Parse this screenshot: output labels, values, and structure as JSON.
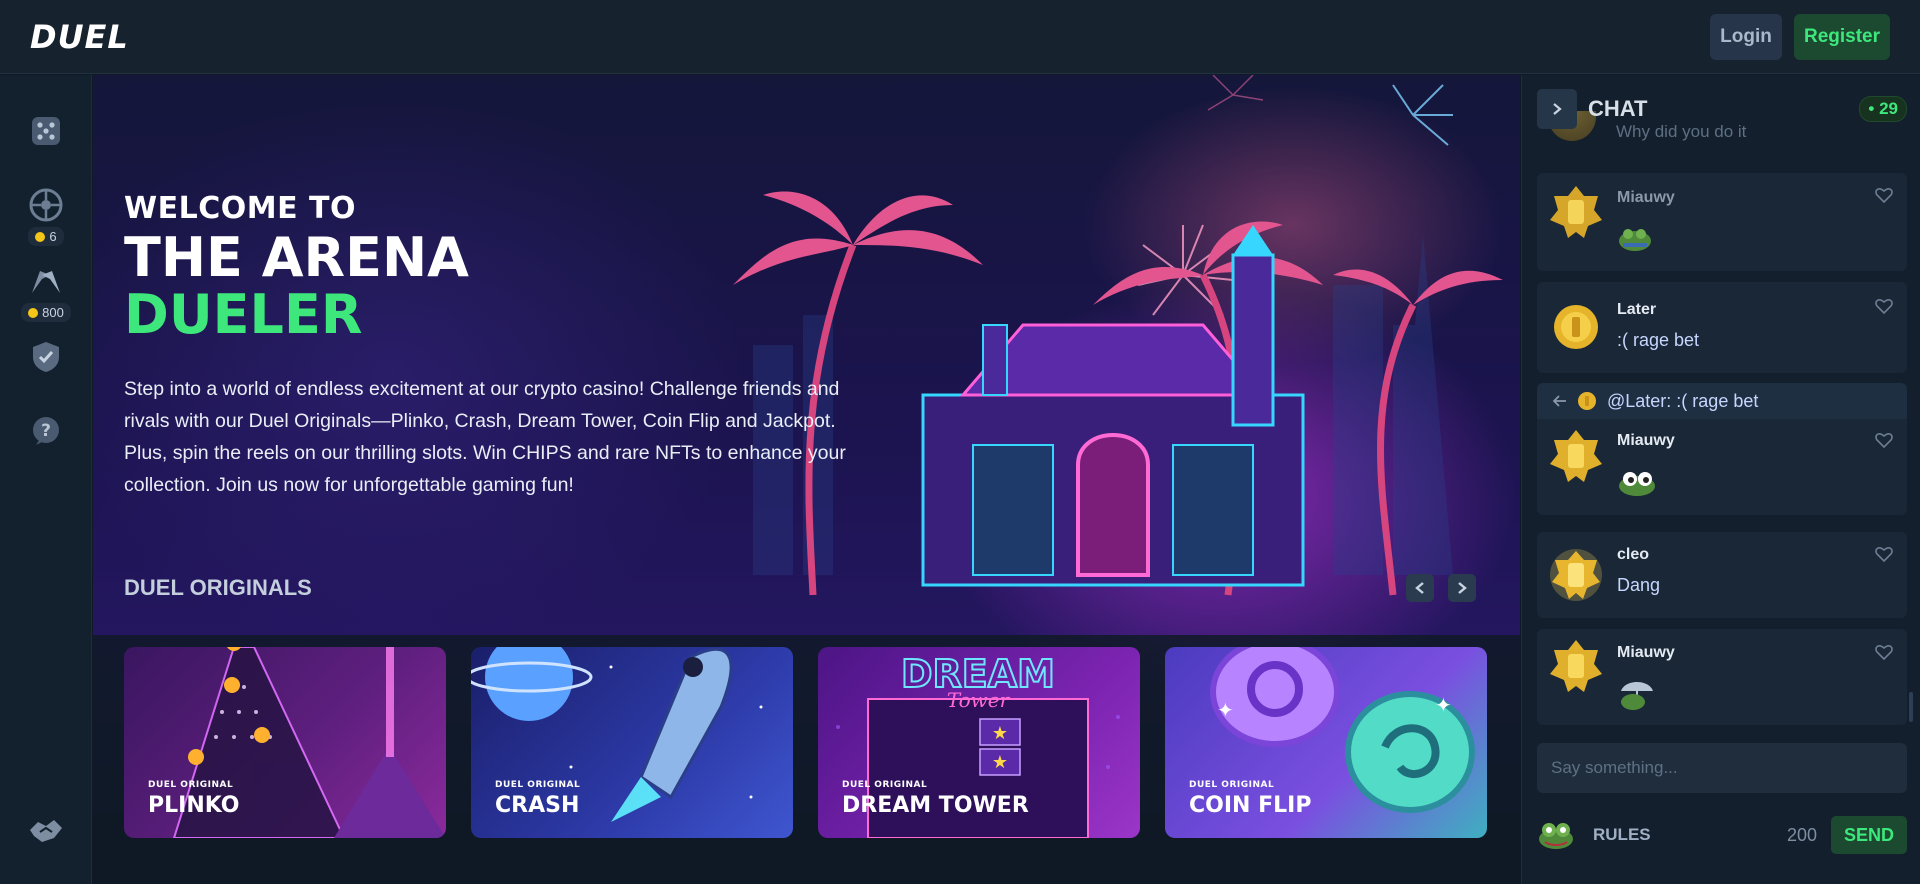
{
  "app": {
    "logo": "DUEL"
  },
  "header": {
    "login_label": "Login",
    "register_label": "Register"
  },
  "leftnav": {
    "items": [
      {
        "name": "dice-icon"
      },
      {
        "name": "wheel-icon",
        "badge": "6"
      },
      {
        "name": "race-flags-icon",
        "badge": "800"
      },
      {
        "name": "shield-icon"
      },
      {
        "name": "help-chat-icon"
      },
      {
        "name": "handshake-icon"
      }
    ]
  },
  "hero": {
    "welcome": "WELCOME TO",
    "arena": "THE ARENA",
    "dueler": "DUELER",
    "description": "Step into a world of endless excitement at our crypto casino! Challenge friends and rivals with our Duel Originals—Plinko, Crash, Dream Tower, Coin Flip and Jackpot. Plus, spin the reels on our thrilling slots. Win CHIPS and rare NFTs to enhance your collection. Join us now for unforgettable gaming fun!"
  },
  "originals": {
    "title": "DUEL ORIGINALS",
    "cards": [
      {
        "sub": "DUEL ORIGINAL",
        "title": "PLINKO"
      },
      {
        "sub": "DUEL ORIGINAL",
        "title": "CRASH"
      },
      {
        "sub": "DUEL ORIGINAL",
        "title": "DREAM TOWER"
      },
      {
        "sub": "DUEL ORIGINAL",
        "title": "COIN FLIP"
      }
    ],
    "dream_tower_art_text": "DREAM",
    "dream_tower_art_sub": "Tower"
  },
  "chat": {
    "title": "CHAT",
    "online": "29",
    "ghost_text": "Why did you do it",
    "messages": [
      {
        "user": "Miauwy",
        "text": ""
      },
      {
        "user": "Later",
        "text": ":( rage bet"
      },
      {
        "reply_to": "@Later: :( rage bet",
        "user": "Miauwy",
        "text": ""
      },
      {
        "user": "cleo",
        "text": "Dang"
      },
      {
        "user": "Miauwy",
        "text": ""
      }
    ],
    "input_placeholder": "Say something...",
    "rules_label": "RULES",
    "char_count": "200",
    "send_label": "SEND"
  },
  "colors": {
    "accent_green": "#3ee77c",
    "bg": "#0f1a26"
  }
}
